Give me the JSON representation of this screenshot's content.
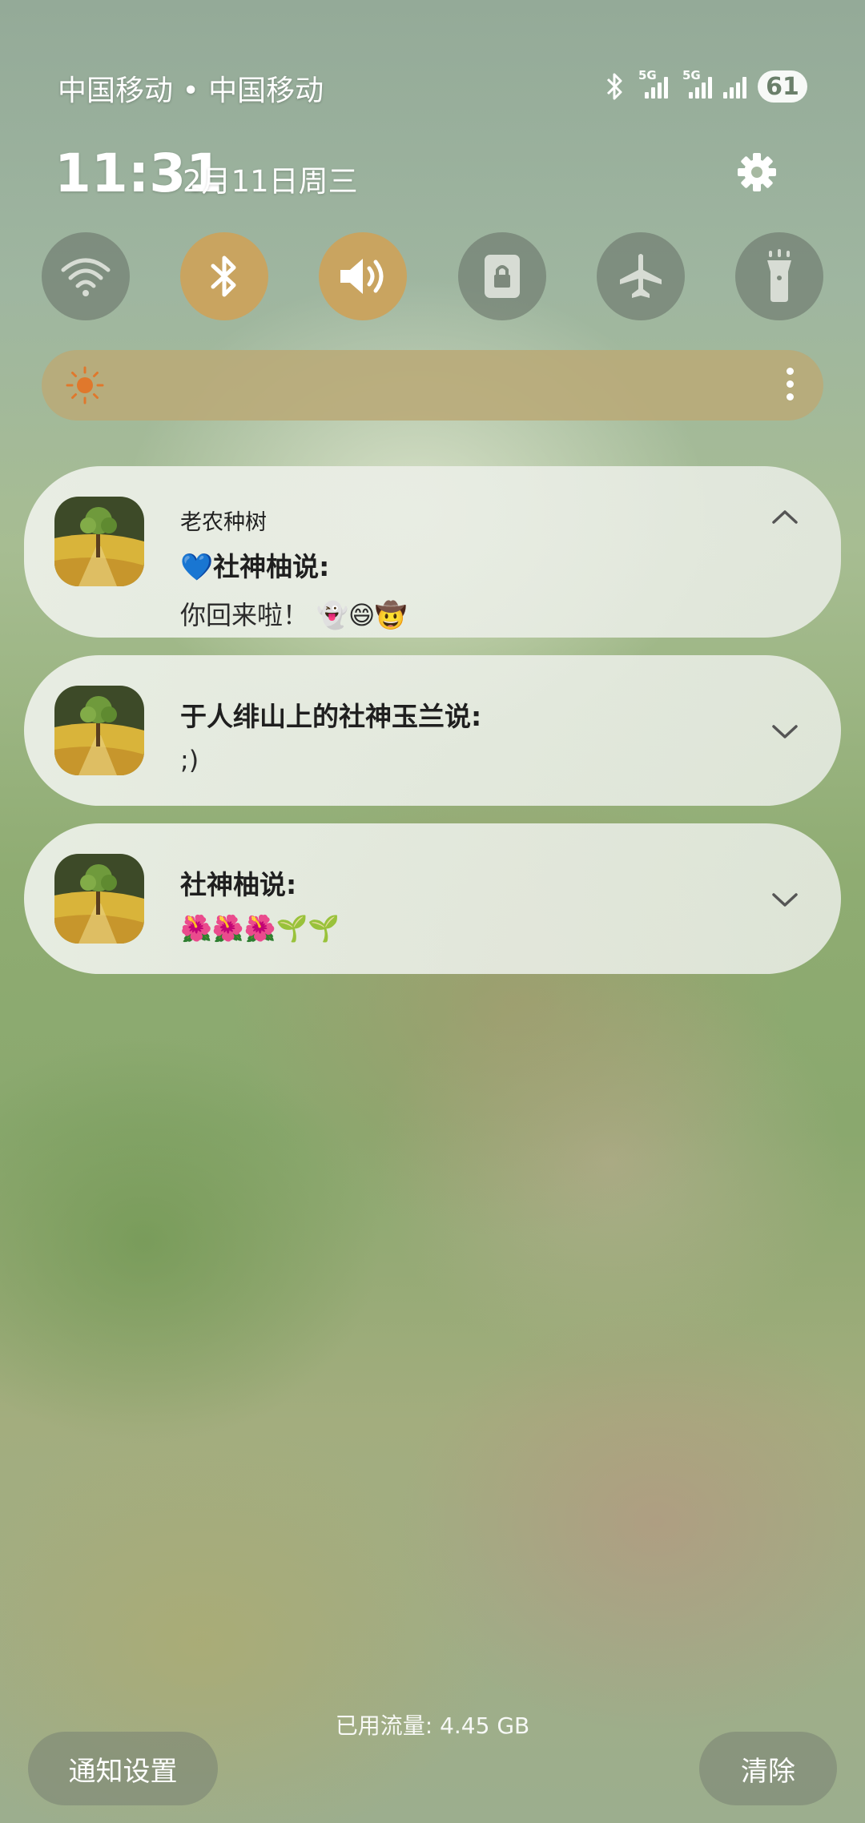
{
  "status_bar": {
    "carrier": "中国移动 • 中国移动",
    "signal_1_tag": "5G",
    "signal_2_tag": "5G",
    "battery": "61"
  },
  "header": {
    "time": "11:31",
    "date": "2月11日周三"
  },
  "quick_settings": [
    {
      "name": "wifi",
      "state": "off"
    },
    {
      "name": "bluetooth",
      "state": "on"
    },
    {
      "name": "sound",
      "state": "on"
    },
    {
      "name": "screen-lock",
      "state": "off"
    },
    {
      "name": "airplane-mode",
      "state": "off"
    },
    {
      "name": "flashlight",
      "state": "off"
    }
  ],
  "colors": {
    "toggle_on": "#c9a460",
    "toggle_off": "#7d897c",
    "brightness_bar": "#b9aa78",
    "sun_icon": "#e0782c"
  },
  "notifications": [
    {
      "app_name": "老农种树",
      "sender": "💙社神柚说:",
      "message": "你回来啦！ 👻😄🤠",
      "expanded": true
    },
    {
      "sender": "于人绯山上的社神玉兰说:",
      "message": ";)",
      "expanded": false
    },
    {
      "sender": "社神柚说:",
      "message": "🌺🌺🌺🌱🌱",
      "expanded": false
    }
  ],
  "footer": {
    "data_usage": "已用流量: 4.45 GB",
    "notification_settings_button": "通知设置",
    "clear_button": "清除"
  }
}
